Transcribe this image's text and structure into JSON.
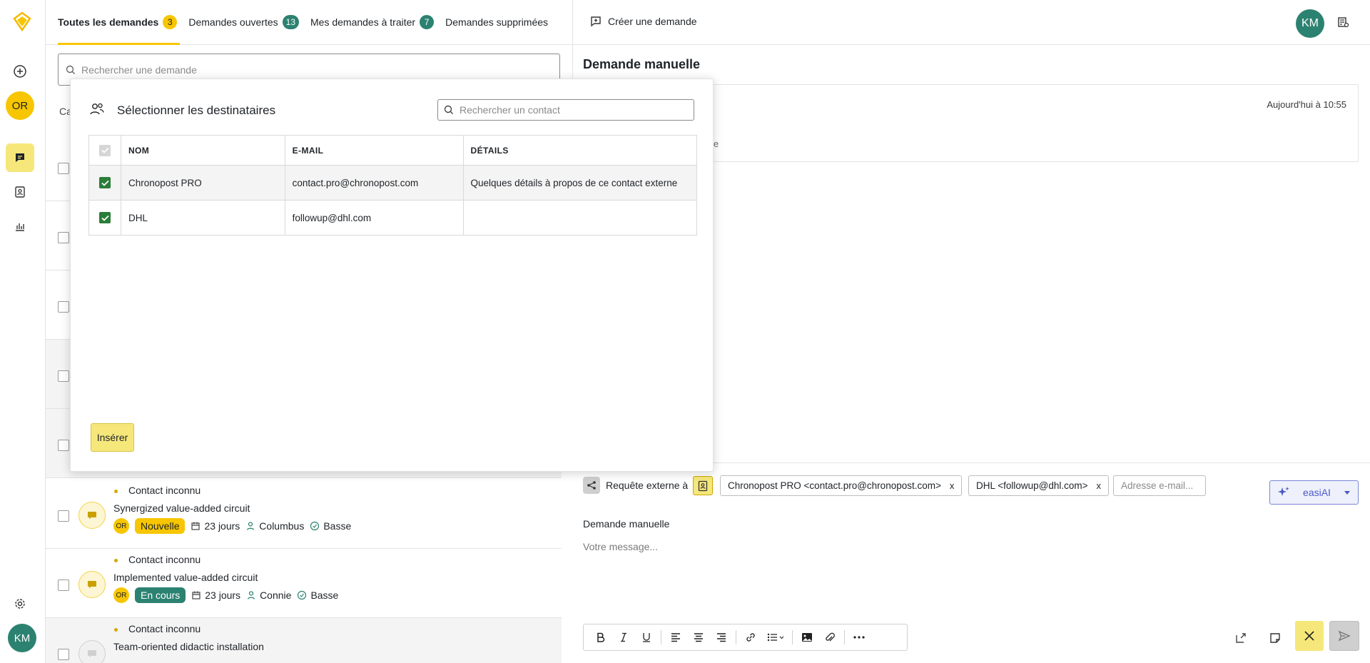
{
  "colors": {
    "accent": "#f7c600",
    "teal": "#2c8270",
    "checkbox_checked": "#2b7d3a",
    "ai_blue": "#4b5ac7"
  },
  "rail": {
    "user_initials_or": "OR",
    "user_initials_km": "KM",
    "icons": [
      "logo",
      "plus-circle-icon",
      "chat-icon",
      "contacts-icon",
      "stats-icon",
      "gear-icon"
    ]
  },
  "tabs": [
    {
      "label": "Toutes les demandes",
      "count": "3"
    },
    {
      "label": "Demandes ouvertes",
      "count": "13"
    },
    {
      "label": "Mes demandes à traiter",
      "count": "7"
    },
    {
      "label": "Demandes supprimées"
    }
  ],
  "search": {
    "placeholder": "Rechercher une demande"
  },
  "list_partial_label": "Ca",
  "rows": [
    {
      "from": "Contact inconnu",
      "subject": "Synergized value-added circuit",
      "owner": "OR",
      "status": "Nouvelle",
      "age": "23 jours",
      "assignee": "Columbus",
      "priority": "Basse"
    },
    {
      "from": "Contact inconnu",
      "subject": "Implemented value-added circuit",
      "owner": "OR",
      "status": "En cours",
      "age": "23 jours",
      "assignee": "Connie",
      "priority": "Basse"
    },
    {
      "from": "Contact inconnu",
      "subject": "Team-oriented didactic installation"
    }
  ],
  "header": {
    "create_label": "Créer une demande",
    "user_initials": "KM"
  },
  "detail": {
    "title": "Demande manuelle",
    "time": "Aujourd'hui à 10:55",
    "fragment": "e"
  },
  "composer": {
    "request_label": "Requête externe à",
    "recipients": [
      {
        "label": "Chronopost PRO <contact.pro@chronopost.com>",
        "remove": "x"
      },
      {
        "label": "DHL <followup@dhl.com>",
        "remove": "x"
      }
    ],
    "email_placeholder": "Adresse e-mail...",
    "ai_label": "easiAI",
    "subject": "Demande manuelle",
    "message_placeholder": "Votre message..."
  },
  "modal": {
    "title": "Sélectionner les destinataires",
    "search_placeholder": "Rechercher un contact",
    "columns": [
      "NOM",
      "E-MAIL",
      "DÉTAILS"
    ],
    "contacts": [
      {
        "name": "Chronopost PRO",
        "email": "contact.pro@chronopost.com",
        "details": "Quelques détails à propos de ce contact externe",
        "checked": true
      },
      {
        "name": "DHL",
        "email": "followup@dhl.com",
        "details": "",
        "checked": true
      }
    ],
    "insert_label": "Insérer"
  }
}
